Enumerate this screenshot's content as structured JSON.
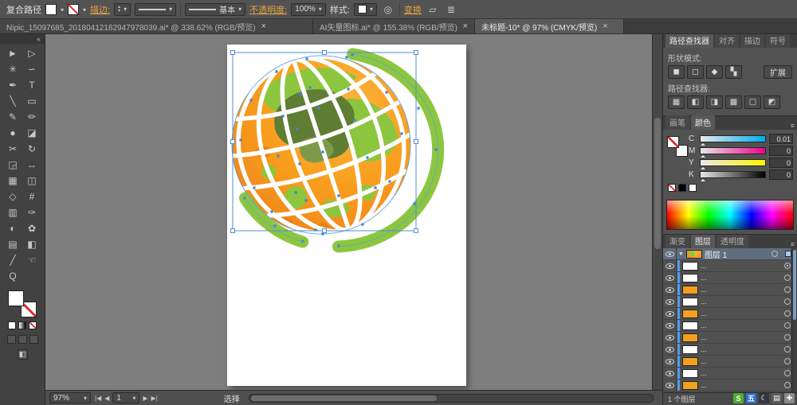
{
  "colors": {
    "accent_link": "#e8a33d",
    "selection_blue": "#4f8fd9",
    "globe_orange": "#f7941e",
    "globe_green": "#8cc63f",
    "canvas_gray": "#7e7e7e",
    "artboard_white": "#ffffff"
  },
  "icons": {
    "close": "×",
    "panel_menu": "≡",
    "caret": "▾"
  },
  "control_bar": {
    "context_label": "复合路径",
    "stroke_link": "描边:",
    "brush_value": "基本",
    "opacity_link": "不透明度:",
    "opacity_value": "100%",
    "style_label": "样式:",
    "transform_link": "变换"
  },
  "document_tabs": {
    "tabs": [
      {
        "label": "Nipic_15097685_20180412182947978039.ai* @ 338.62% (RGB/预览)",
        "active": false
      },
      {
        "label": "AI矢量图标.ai* @ 155.38% (RGB/预览)",
        "active": false
      },
      {
        "label": "未标题-10* @ 97% (CMYK/预览)",
        "active": true
      }
    ]
  },
  "toolbar": {
    "collapse_glyph": "«",
    "tools": [
      {
        "name": "selection-tool-icon",
        "glyph": "►"
      },
      {
        "name": "direct-selection-tool-icon",
        "glyph": "▷"
      },
      {
        "name": "magic-wand-tool-icon",
        "glyph": "✳"
      },
      {
        "name": "lasso-tool-icon",
        "glyph": "∽"
      },
      {
        "name": "pen-tool-icon",
        "glyph": "✒"
      },
      {
        "name": "type-tool-icon",
        "glyph": "T"
      },
      {
        "name": "line-segment-tool-icon",
        "glyph": "╲"
      },
      {
        "name": "rectangle-tool-icon",
        "glyph": "▭"
      },
      {
        "name": "paintbrush-tool-icon",
        "glyph": "✎"
      },
      {
        "name": "pencil-tool-icon",
        "glyph": "✏"
      },
      {
        "name": "blob-brush-tool-icon",
        "glyph": "●"
      },
      {
        "name": "eraser-tool-icon",
        "glyph": "◪"
      },
      {
        "name": "scissors-tool-icon",
        "glyph": "✂"
      },
      {
        "name": "rotate-tool-icon",
        "glyph": "↻"
      },
      {
        "name": "scale-tool-icon",
        "glyph": "◲"
      },
      {
        "name": "width-tool-icon",
        "glyph": "↔"
      },
      {
        "name": "free-transform-tool-icon",
        "glyph": "▦"
      },
      {
        "name": "shape-builder-tool-icon",
        "glyph": "◫"
      },
      {
        "name": "perspective-grid-tool-icon",
        "glyph": "◇"
      },
      {
        "name": "mesh-tool-icon",
        "glyph": "#"
      },
      {
        "name": "gradient-tool-icon",
        "glyph": "▥"
      },
      {
        "name": "eyedropper-tool-icon",
        "glyph": "✑"
      },
      {
        "name": "blend-tool-icon",
        "glyph": "◐"
      },
      {
        "name": "symbol-sprayer-tool-icon",
        "glyph": "✿"
      },
      {
        "name": "column-graph-tool-icon",
        "glyph": "▤"
      },
      {
        "name": "artboard-tool-icon",
        "glyph": "◧"
      },
      {
        "name": "slice-tool-icon",
        "glyph": "╱"
      },
      {
        "name": "hand-tool-icon",
        "glyph": "☜"
      },
      {
        "name": "zoom-tool-icon",
        "glyph": "Q"
      }
    ]
  },
  "pathfinder_panel": {
    "tabs": [
      {
        "label": "路径查找器"
      },
      {
        "label": "对齐"
      },
      {
        "label": "描边"
      },
      {
        "label": "符号"
      }
    ],
    "shape_modes_label": "形状模式:",
    "shape_mode_buttons": [
      {
        "name": "unite",
        "glyph": "◼"
      },
      {
        "name": "minus-front",
        "glyph": "◻"
      },
      {
        "name": "intersect",
        "glyph": "◆"
      },
      {
        "name": "exclude",
        "glyph": "▚"
      }
    ],
    "expand_button": "扩展",
    "pathfinder_label": "路径查找器:",
    "pathfinder_buttons": [
      {
        "name": "divide",
        "glyph": "▦"
      },
      {
        "name": "trim",
        "glyph": "◧"
      },
      {
        "name": "merge",
        "glyph": "◨"
      },
      {
        "name": "crop",
        "glyph": "▩"
      },
      {
        "name": "outline",
        "glyph": "▢"
      },
      {
        "name": "minus-back",
        "glyph": "◩"
      }
    ]
  },
  "color_panel": {
    "tabs": [
      {
        "label": "画笔"
      },
      {
        "label": "颜色"
      }
    ],
    "channels": [
      {
        "label": "C",
        "value": "0.01"
      },
      {
        "label": "M",
        "value": "0"
      },
      {
        "label": "Y",
        "value": "0"
      },
      {
        "label": "K",
        "value": "0"
      }
    ]
  },
  "layers_panel": {
    "tabs": [
      {
        "label": "渐变"
      },
      {
        "label": "图层"
      },
      {
        "label": "透明度"
      }
    ],
    "rows": [
      {
        "name": "图层 1",
        "root": true,
        "thumb": "globe",
        "selected_chip": true
      },
      {
        "name": "...",
        "thumb": "#ffffff",
        "targeted": true
      },
      {
        "name": "...",
        "thumb": "#ffffff"
      },
      {
        "name": "...",
        "thumb": "#f4a01f"
      },
      {
        "name": "...",
        "thumb": "#ffffff"
      },
      {
        "name": "...",
        "thumb": "#f4a01f"
      },
      {
        "name": "...",
        "thumb": "#ffffff"
      },
      {
        "name": "...",
        "thumb": "#f4a01f"
      },
      {
        "name": "...",
        "thumb": "#ffffff"
      },
      {
        "name": "...",
        "thumb": "#f4a01f"
      },
      {
        "name": "...",
        "thumb": "#ffffff"
      },
      {
        "name": "...",
        "thumb": "#f4a01f"
      }
    ],
    "footer_count": "1 个图层"
  },
  "status_bar": {
    "zoom_value": "97%",
    "nav_first": "|◀",
    "nav_prev": "◀",
    "artboard_value": "1",
    "nav_next": "▶",
    "nav_last": "▶|",
    "status_text": "选择"
  },
  "taskbar": {
    "icons": [
      {
        "name": "sogou-icon",
        "glyph": "S",
        "bg": "#4caf35"
      },
      {
        "name": "wubi-input-icon",
        "glyph": "五",
        "bg": "#2f6fd2"
      },
      {
        "name": "moon-mode-icon",
        "glyph": "☾",
        "bg": "#33373e"
      },
      {
        "name": "keyboard-icon",
        "glyph": "▤",
        "bg": "#5d5d5d"
      },
      {
        "name": "toolbox-icon",
        "glyph": "✚",
        "bg": "#8a8a8a"
      }
    ]
  }
}
